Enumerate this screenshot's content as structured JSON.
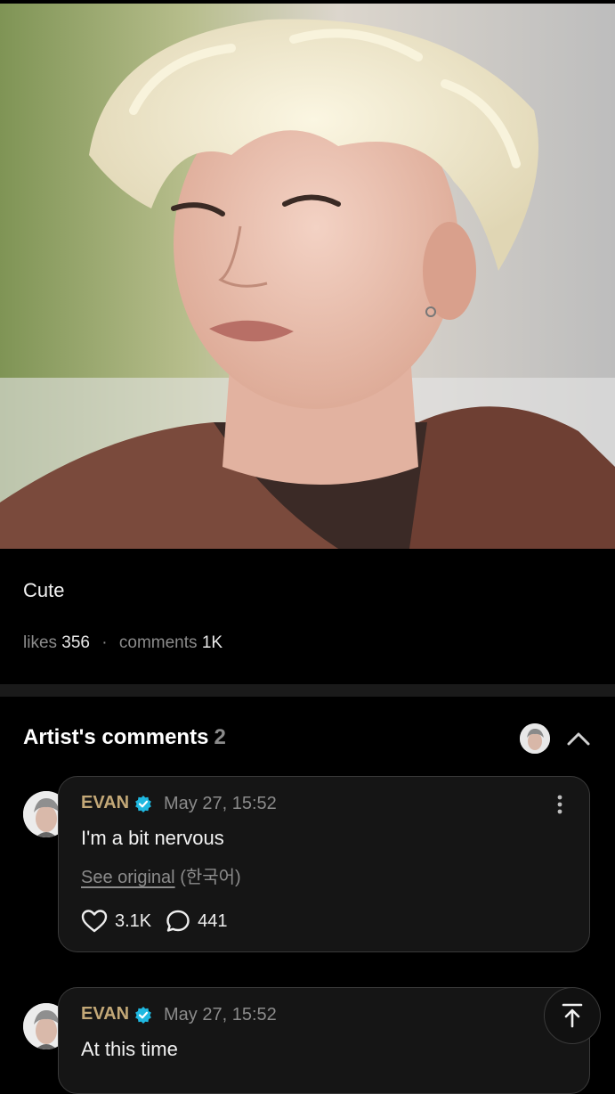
{
  "post": {
    "image_alt": "Photo of artist with platinum blonde curly hair",
    "caption": "Cute",
    "likes_label": "likes",
    "likes_count": "356",
    "comments_label": "comments",
    "comments_count": "1K"
  },
  "artist_comments": {
    "title": "Artist's comments",
    "count": "2",
    "items": [
      {
        "author": "EVAN",
        "date": "May 27, 15:52",
        "text": "I'm a bit nervous",
        "see_original": "See original",
        "language": "(한국어)",
        "likes": "3.1K",
        "replies": "441"
      },
      {
        "author": "EVAN",
        "date": "May 27, 15:52",
        "text": "At this time"
      }
    ]
  },
  "colors": {
    "background": "#000000",
    "author_name": "#c3a877",
    "verified_badge": "#1fb8e0",
    "muted_text": "#8b8b8b"
  },
  "icons": {
    "verified": "verified-badge-icon",
    "more": "more-vertical-icon",
    "like": "heart-icon",
    "reply": "comment-bubble-icon",
    "collapse": "chevron-up-icon",
    "scroll_top": "arrow-to-top-icon"
  }
}
